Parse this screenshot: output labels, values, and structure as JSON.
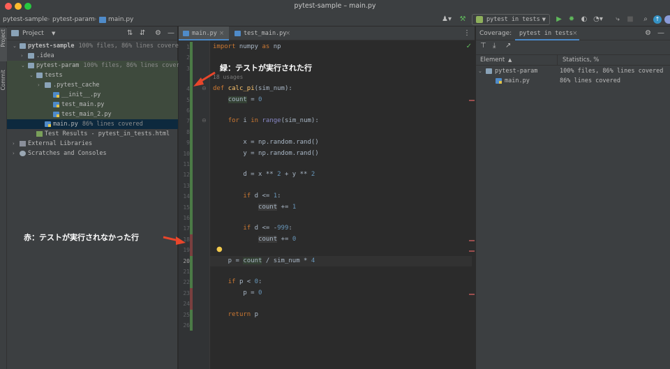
{
  "window": {
    "title": "pytest-sample – main.py"
  },
  "navbar": {
    "breadcrumbs": [
      "pytest-sample",
      "pytest-param",
      "main.py"
    ],
    "run_config": "pytest in tests"
  },
  "left_stripe": {
    "project_label": "Project",
    "commit_label": "Commit"
  },
  "project_panel": {
    "title": "Project",
    "tree": [
      {
        "label": "pytest-sample",
        "coverage": "100% files, 86% lines covered",
        "type": "folder",
        "level": 0,
        "expanded": true,
        "bold": true
      },
      {
        "label": ".idea",
        "coverage": "",
        "type": "folder",
        "level": 1,
        "expanded": false
      },
      {
        "label": "pytest-param",
        "coverage": "100% files, 86% lines covered",
        "type": "folder",
        "level": 1,
        "expanded": true
      },
      {
        "label": "tests",
        "coverage": "",
        "type": "folder",
        "level": 2,
        "expanded": true
      },
      {
        "label": ".pytest_cache",
        "coverage": "",
        "type": "folder",
        "level": 3,
        "expanded": false
      },
      {
        "label": "__init__.py",
        "coverage": "",
        "type": "py",
        "level": 4
      },
      {
        "label": "test_main.py",
        "coverage": "",
        "type": "py",
        "level": 4
      },
      {
        "label": "test_main_2.py",
        "coverage": "",
        "type": "py",
        "level": 4
      },
      {
        "label": "main.py",
        "coverage": "86% lines covered",
        "type": "py",
        "level": 3,
        "selected": true
      },
      {
        "label": "Test Results - pytest_in_tests.html",
        "coverage": "",
        "type": "html",
        "level": 2
      },
      {
        "label": "External Libraries",
        "coverage": "",
        "type": "lib",
        "level": 0,
        "expanded": false
      },
      {
        "label": "Scratches and Consoles",
        "coverage": "",
        "type": "scratch",
        "level": 0,
        "expanded": false
      }
    ]
  },
  "editor": {
    "tabs": [
      {
        "label": "main.py",
        "active": true
      },
      {
        "label": "test_main.py",
        "active": false
      }
    ],
    "usages_hint": "18 usages",
    "lines": [
      {
        "n": "1",
        "cov": "green",
        "code": [
          [
            "kw",
            "import"
          ],
          [
            "t",
            " numpy "
          ],
          [
            "kw",
            "as"
          ],
          [
            "t",
            " np"
          ]
        ]
      },
      {
        "n": "2",
        "cov": "green",
        "code": []
      },
      {
        "n": "3",
        "cov": "green",
        "code": []
      },
      {
        "n": "4",
        "cov": "green",
        "code": [
          [
            "kw",
            "def"
          ],
          [
            "t",
            " "
          ],
          [
            "fn",
            "calc_pi"
          ],
          [
            "t",
            "(sim_num):"
          ]
        ]
      },
      {
        "n": "5",
        "cov": "green",
        "code": [
          [
            "t",
            "    "
          ],
          [
            "hl",
            "count"
          ],
          [
            "t",
            " = "
          ],
          [
            "num",
            "0"
          ]
        ]
      },
      {
        "n": "6",
        "cov": "green",
        "code": []
      },
      {
        "n": "7",
        "cov": "green",
        "code": [
          [
            "t",
            "    "
          ],
          [
            "kw",
            "for"
          ],
          [
            "t",
            " i "
          ],
          [
            "kw",
            "in"
          ],
          [
            "t",
            " "
          ],
          [
            "bi",
            "range"
          ],
          [
            "t",
            "(sim_num):"
          ]
        ]
      },
      {
        "n": "8",
        "cov": "green",
        "code": []
      },
      {
        "n": "9",
        "cov": "green",
        "code": [
          [
            "t",
            "        x = np.random.rand()"
          ]
        ]
      },
      {
        "n": "10",
        "cov": "green",
        "code": [
          [
            "t",
            "        y = np.random.rand()"
          ]
        ]
      },
      {
        "n": "11",
        "cov": "green",
        "code": []
      },
      {
        "n": "12",
        "cov": "green",
        "code": [
          [
            "t",
            "        d = x ** "
          ],
          [
            "num",
            "2"
          ],
          [
            "t",
            " + y ** "
          ],
          [
            "num",
            "2"
          ]
        ]
      },
      {
        "n": "13",
        "cov": "green",
        "code": []
      },
      {
        "n": "14",
        "cov": "green",
        "code": [
          [
            "t",
            "        "
          ],
          [
            "kw",
            "if"
          ],
          [
            "t",
            " d <= "
          ],
          [
            "num",
            "1"
          ],
          [
            "t",
            ":"
          ]
        ]
      },
      {
        "n": "15",
        "cov": "green",
        "code": [
          [
            "t",
            "            "
          ],
          [
            "hlr",
            "count"
          ],
          [
            "t",
            " += "
          ],
          [
            "num",
            "1"
          ]
        ]
      },
      {
        "n": "16",
        "cov": "green",
        "code": []
      },
      {
        "n": "17",
        "cov": "green",
        "code": [
          [
            "t",
            "        "
          ],
          [
            "kw",
            "if"
          ],
          [
            "t",
            " d <= -"
          ],
          [
            "num",
            "999"
          ],
          [
            "t",
            ":"
          ]
        ]
      },
      {
        "n": "18",
        "cov": "red",
        "code": [
          [
            "t",
            "            "
          ],
          [
            "hlr",
            "count"
          ],
          [
            "t",
            " += "
          ],
          [
            "num",
            "0"
          ]
        ]
      },
      {
        "n": "19",
        "cov": "red",
        "code": []
      },
      {
        "n": "20",
        "cov": "green",
        "code": [
          [
            "t",
            "    p = "
          ],
          [
            "hl",
            "count"
          ],
          [
            "t",
            " / sim_num * "
          ],
          [
            "num",
            "4"
          ]
        ]
      },
      {
        "n": "21",
        "cov": "green",
        "code": []
      },
      {
        "n": "22",
        "cov": "green",
        "code": [
          [
            "t",
            "    "
          ],
          [
            "kw",
            "if"
          ],
          [
            "t",
            " p < "
          ],
          [
            "num",
            "0"
          ],
          [
            "t",
            ":"
          ]
        ]
      },
      {
        "n": "23",
        "cov": "red",
        "code": [
          [
            "t",
            "        p = "
          ],
          [
            "num",
            "0"
          ]
        ]
      },
      {
        "n": "24",
        "cov": "red",
        "code": []
      },
      {
        "n": "25",
        "cov": "green",
        "code": [
          [
            "t",
            "    "
          ],
          [
            "kw",
            "return"
          ],
          [
            "t",
            " p"
          ]
        ]
      },
      {
        "n": "26",
        "cov": "green",
        "code": []
      }
    ]
  },
  "annotations": {
    "green": "緑：テストが実行された行",
    "red": "赤：テストが実行されなかった行"
  },
  "coverage_panel": {
    "label": "Coverage:",
    "tab": "pytest in tests",
    "col_element": "Element",
    "col_stats": "Statistics, %",
    "rows": [
      {
        "name": "pytest-param",
        "stats": "100% files, 86% lines covered",
        "type": "folder"
      },
      {
        "name": "main.py",
        "stats": "86% lines covered",
        "type": "py"
      }
    ]
  },
  "colors": {
    "covered_green": "#4b7a46",
    "uncovered_red": "#7a3f3f",
    "annotation_arrow": "#e8462b",
    "selection": "#0d293e"
  }
}
